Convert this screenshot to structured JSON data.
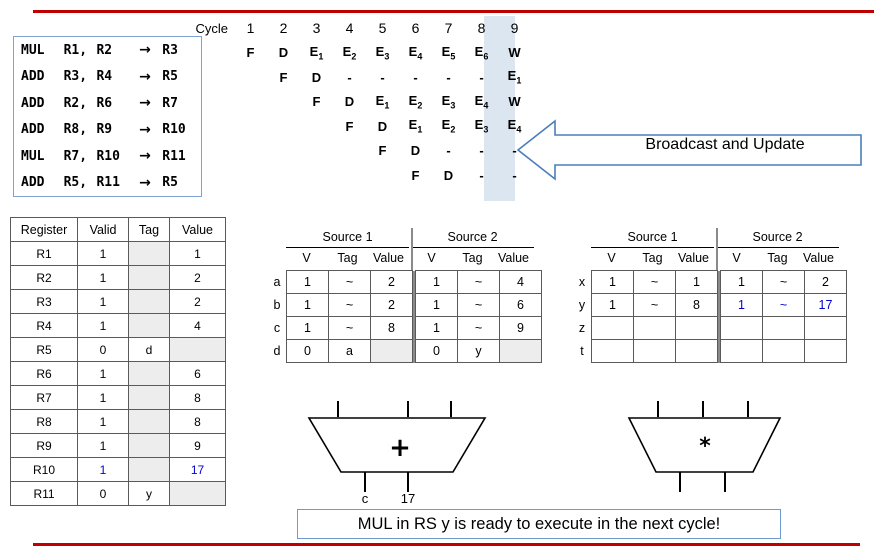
{
  "colors": {
    "rule": "#C00000",
    "accent_border": "#7FA3CE",
    "highlight_bg": "#DCE6F1",
    "blue_text": "#0000D4",
    "grey_cell": "#EDEDED"
  },
  "instructions": {
    "rows": [
      {
        "op": "MUL",
        "src1": "R1,",
        "src2": "R2",
        "arrow": "→",
        "dest": "R3"
      },
      {
        "op": "ADD",
        "src1": "R3,",
        "src2": "R4",
        "arrow": "→",
        "dest": "R5"
      },
      {
        "op": "ADD",
        "src1": "R2,",
        "src2": "R6",
        "arrow": "→",
        "dest": "R7"
      },
      {
        "op": "ADD",
        "src1": "R8,",
        "src2": "R9",
        "arrow": "→",
        "dest": "R10"
      },
      {
        "op": "MUL",
        "src1": "R7,",
        "src2": "R10",
        "arrow": "→",
        "dest": "R11"
      },
      {
        "op": "ADD",
        "src1": "R5,",
        "src2": "R11",
        "arrow": "→",
        "dest": "R5"
      }
    ]
  },
  "pipeline": {
    "cycle_label": "Cycle",
    "cycles": [
      "1",
      "2",
      "3",
      "4",
      "5",
      "6",
      "7",
      "8",
      "9"
    ],
    "highlighted_cycle": "9",
    "rows": [
      [
        "F",
        "D",
        "E1",
        "E2",
        "E3",
        "E4",
        "E5",
        "E6",
        "W"
      ],
      [
        "",
        "F",
        "D",
        "-",
        "-",
        "-",
        "-",
        "-",
        "E1"
      ],
      [
        "",
        "",
        "F",
        "D",
        "E1",
        "E2",
        "E3",
        "E4",
        "W"
      ],
      [
        "",
        "",
        "",
        "F",
        "D",
        "E1",
        "E2",
        "E3",
        "E4"
      ],
      [
        "",
        "",
        "",
        "",
        "F",
        "D",
        "-",
        "-",
        "-"
      ],
      [
        "",
        "",
        "",
        "",
        "",
        "F",
        "D",
        "-",
        "-"
      ]
    ]
  },
  "broadcast": {
    "label": "Broadcast and Update"
  },
  "register_file": {
    "headers": [
      "Register",
      "Valid",
      "Tag",
      "Value"
    ],
    "rows": [
      {
        "reg": "R1",
        "valid": "1",
        "tag": "",
        "value": "1",
        "tag_grey": true,
        "value_grey": false,
        "highlight": false
      },
      {
        "reg": "R2",
        "valid": "1",
        "tag": "",
        "value": "2",
        "tag_grey": true,
        "value_grey": false,
        "highlight": false
      },
      {
        "reg": "R3",
        "valid": "1",
        "tag": "",
        "value": "2",
        "tag_grey": true,
        "value_grey": false,
        "highlight": false
      },
      {
        "reg": "R4",
        "valid": "1",
        "tag": "",
        "value": "4",
        "tag_grey": true,
        "value_grey": false,
        "highlight": false
      },
      {
        "reg": "R5",
        "valid": "0",
        "tag": "d",
        "value": "",
        "tag_grey": false,
        "value_grey": true,
        "highlight": false
      },
      {
        "reg": "R6",
        "valid": "1",
        "tag": "",
        "value": "6",
        "tag_grey": true,
        "value_grey": false,
        "highlight": false
      },
      {
        "reg": "R7",
        "valid": "1",
        "tag": "",
        "value": "8",
        "tag_grey": true,
        "value_grey": false,
        "highlight": false
      },
      {
        "reg": "R8",
        "valid": "1",
        "tag": "",
        "value": "8",
        "tag_grey": true,
        "value_grey": false,
        "highlight": false
      },
      {
        "reg": "R9",
        "valid": "1",
        "tag": "",
        "value": "9",
        "tag_grey": true,
        "value_grey": false,
        "highlight": false
      },
      {
        "reg": "R10",
        "valid": "1",
        "tag": "",
        "value": "17",
        "tag_grey": true,
        "value_grey": true,
        "highlight": true
      },
      {
        "reg": "R11",
        "valid": "0",
        "tag": "y",
        "value": "",
        "tag_grey": false,
        "value_grey": true,
        "highlight": false
      }
    ]
  },
  "rs_add": {
    "source1_title": "Source 1",
    "source2_title": "Source 2",
    "col_headers": [
      "V",
      "Tag",
      "Value"
    ],
    "rows": [
      {
        "name": "a",
        "s1v": "1",
        "s1tag": "~",
        "s1val": "2",
        "s1val_grey": false,
        "s2v": "1",
        "s2tag": "~",
        "s2val": "4",
        "s2val_grey": false,
        "blue": false
      },
      {
        "name": "b",
        "s1v": "1",
        "s1tag": "~",
        "s1val": "2",
        "s1val_grey": false,
        "s2v": "1",
        "s2tag": "~",
        "s2val": "6",
        "s2val_grey": false,
        "blue": false
      },
      {
        "name": "c",
        "s1v": "1",
        "s1tag": "~",
        "s1val": "8",
        "s1val_grey": false,
        "s2v": "1",
        "s2tag": "~",
        "s2val": "9",
        "s2val_grey": false,
        "blue": false
      },
      {
        "name": "d",
        "s1v": "0",
        "s1tag": "a",
        "s1val": "",
        "s1val_grey": true,
        "s2v": "0",
        "s2tag": "y",
        "s2val": "",
        "s2val_grey": true,
        "blue": false
      }
    ]
  },
  "rs_mul": {
    "source1_title": "Source 1",
    "source2_title": "Source 2",
    "col_headers": [
      "V",
      "Tag",
      "Value"
    ],
    "rows": [
      {
        "name": "x",
        "s1v": "1",
        "s1tag": "~",
        "s1val": "1",
        "s1val_grey": false,
        "s2v": "1",
        "s2tag": "~",
        "s2val": "2",
        "s2val_grey": false,
        "blue": false
      },
      {
        "name": "y",
        "s1v": "1",
        "s1tag": "~",
        "s1val": "8",
        "s1val_grey": false,
        "s2v": "1",
        "s2tag": "~",
        "s2val": "17",
        "s2val_grey": false,
        "blue": true
      },
      {
        "name": "z",
        "s1v": "",
        "s1tag": "",
        "s1val": "",
        "s1val_grey": false,
        "s2v": "",
        "s2tag": "",
        "s2val": "",
        "s2val_grey": false,
        "blue": false
      },
      {
        "name": "t",
        "s1v": "",
        "s1tag": "",
        "s1val": "",
        "s1val_grey": false,
        "s2v": "",
        "s2tag": "",
        "s2val": "",
        "s2val_grey": false,
        "blue": false
      }
    ]
  },
  "alu_add": {
    "symbol": "+",
    "out_left_label": "c",
    "out_right_label": "17"
  },
  "alu_mul": {
    "symbol": "*",
    "out_left_label": "",
    "out_right_label": ""
  },
  "caption": {
    "text": "MUL in RS y is ready to execute in the next cycle!"
  }
}
